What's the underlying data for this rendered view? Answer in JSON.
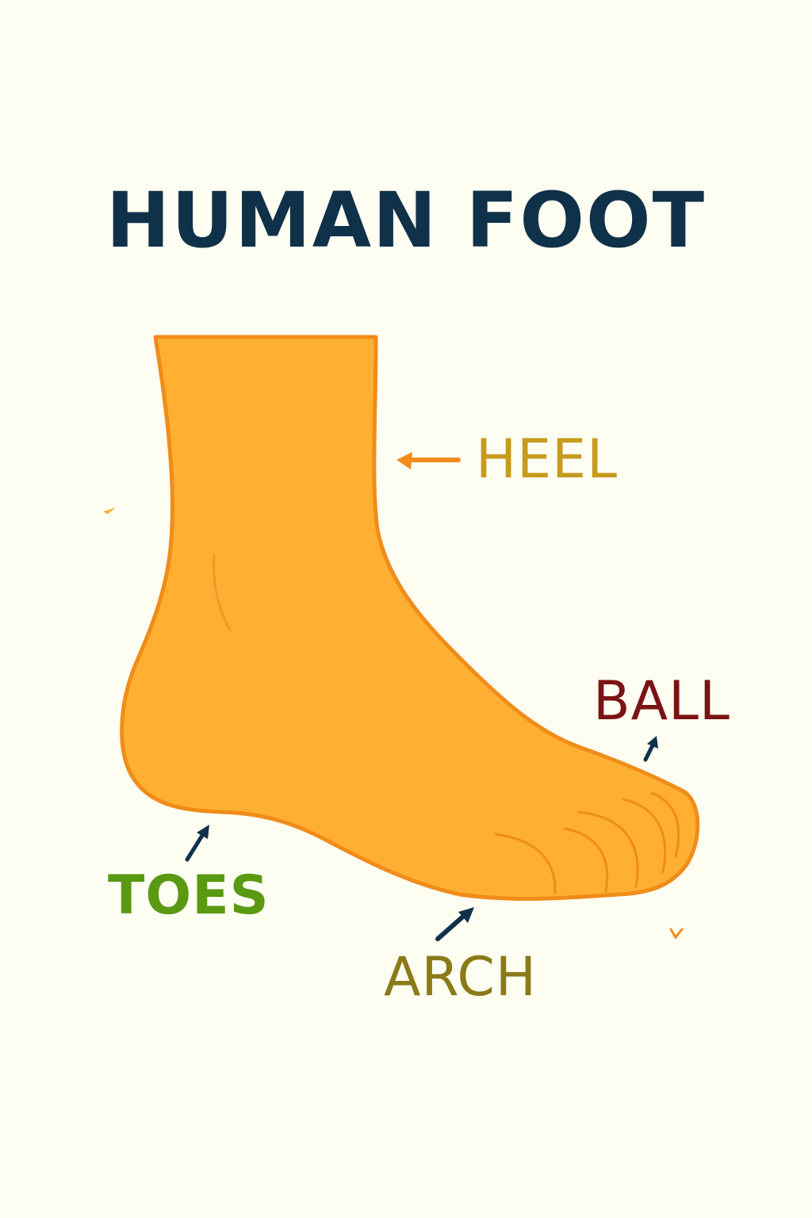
{
  "title": "HUMAN FOOT",
  "labels": {
    "heel": "HEEL",
    "ball": "BALL",
    "toes": "TOES",
    "arch": "ARCH"
  },
  "colors": {
    "background": "#fdfdf2",
    "title": "#10314a",
    "foot_fill": "#ffb033",
    "foot_outline": "#f08c1a",
    "heel": "#c79b1e",
    "ball": "#7a1414",
    "toes": "#5a9a12",
    "arch": "#8a7a18",
    "arrow_dark": "#10314a",
    "arrow_orange": "#f08c1a"
  }
}
